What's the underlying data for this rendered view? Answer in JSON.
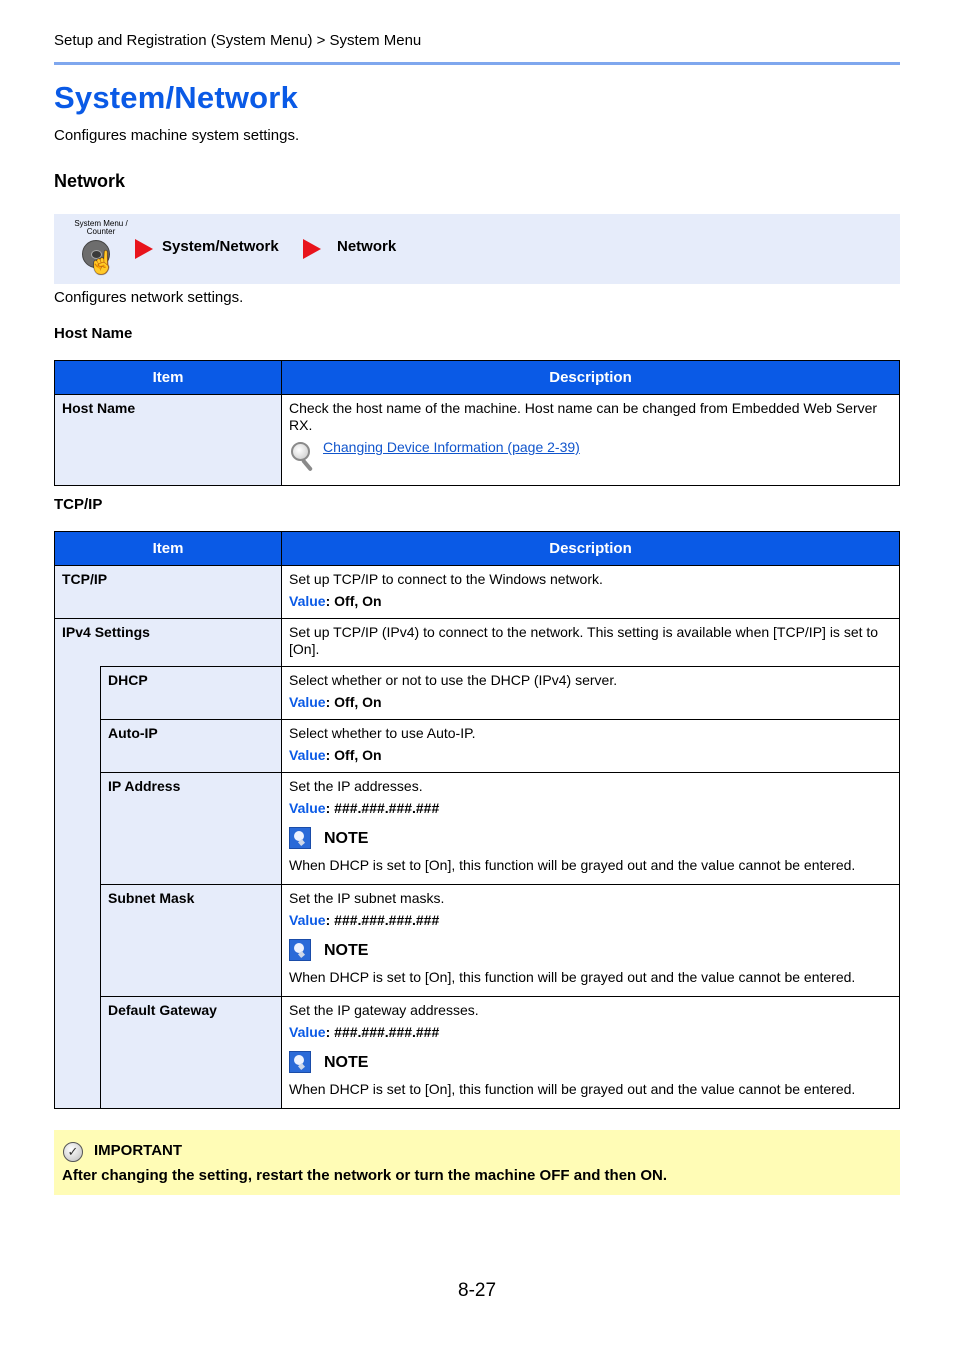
{
  "header": {
    "breadcrumb": "Setup and Registration (System Menu) > System Menu",
    "title": "System/Network",
    "subtitle": "Configures machine system settings."
  },
  "section": {
    "title": "Network",
    "nav_path": {
      "button_label": "System Menu / Counter",
      "steps": [
        "System/Network",
        "Network"
      ]
    },
    "description": "Configures network settings."
  },
  "host_name_table": {
    "heading": "Host Name",
    "columns": [
      "Item",
      "Description"
    ],
    "rows": [
      {
        "item": "Host Name",
        "description": "Check the host name of the machine. Host name can be changed from Embedded Web Server RX.",
        "link": "Changing Device Information (page 2-39)"
      }
    ]
  },
  "tcpip_table": {
    "heading": "TCP/IP",
    "columns": [
      "Item",
      "Description"
    ],
    "value_label": "Value",
    "note_label": "NOTE",
    "rows": [
      {
        "item": "TCP/IP",
        "description": "Set up TCP/IP to connect to the Windows network.",
        "value": "Off, On"
      },
      {
        "item": "IPv4 Settings",
        "description": "Set up TCP/IP (IPv4) to connect to the network. This setting is available when [TCP/IP] is set to [On]."
      },
      {
        "item": "DHCP",
        "description": "Select whether or not to use the DHCP (IPv4) server.",
        "value": "Off, On"
      },
      {
        "item": "Auto-IP",
        "description": "Select whether to use Auto-IP.",
        "value": "Off, On"
      },
      {
        "item": "IP Address",
        "description": "Set the IP addresses.",
        "value": "###.###.###.###",
        "note": "When DHCP is set to [On], this function will be grayed out and the value cannot be entered."
      },
      {
        "item": "Subnet Mask",
        "description": "Set the IP subnet masks.",
        "value": "###.###.###.###",
        "note": "When DHCP is set to [On], this function will be grayed out and the value cannot be entered."
      },
      {
        "item": "Default Gateway",
        "description": "Set the IP gateway addresses.",
        "value": "###.###.###.###",
        "note": "When DHCP is set to [On], this function will be grayed out and the value cannot be entered."
      }
    ]
  },
  "important": {
    "label": "IMPORTANT",
    "text": "After changing the setting, restart the network or turn the machine OFF and then ON."
  },
  "footer": {
    "page_number": "8-27"
  }
}
